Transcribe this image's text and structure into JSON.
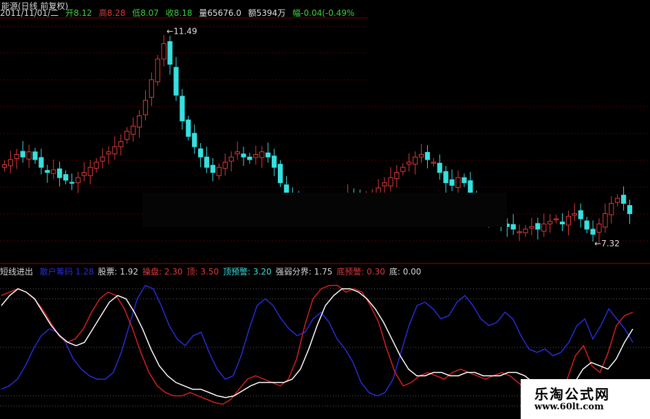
{
  "header": {
    "stock_name": "能源(日线 前复权)",
    "date": "2011/11/01/二",
    "open_label": "开",
    "open": "8.12",
    "high_label": "高",
    "high": "8.28",
    "low_label": "低",
    "low": "8.07",
    "close_label": "收",
    "close": "8.18",
    "volume_label": "量",
    "volume": "65676.0",
    "amount_label": "额",
    "amount": "5394万",
    "change_label": "幅",
    "change": "-0.04(-0.49%"
  },
  "price_annotations": {
    "high_mark": "11.49",
    "low_mark": "7.32"
  },
  "indicator_legend": {
    "name": "短线进出",
    "items": [
      {
        "label": "散户筹码",
        "value": "1.28",
        "color": "#2b2bd8"
      },
      {
        "label": "股票:",
        "value": "1.92",
        "color": "#d8d8d8"
      },
      {
        "label": "操盘:",
        "value": "2.30",
        "color": "#e03a3a"
      },
      {
        "label": "顶:",
        "value": "3.50",
        "color": "#e03a3a"
      },
      {
        "label": "顶预警:",
        "value": "3.20",
        "color": "#37e0e0"
      },
      {
        "label": "强弱分界:",
        "value": "1.75",
        "color": "#d8d8d8"
      },
      {
        "label": "底预警:",
        "value": "0.30",
        "color": "#e03a3a"
      },
      {
        "label": "底:",
        "value": "0.00",
        "color": "#d8d8d8"
      }
    ]
  },
  "watermark": {
    "line1": "乐淘公式网",
    "line2": "www.60lt.com"
  },
  "colors": {
    "up": "#e03a3a",
    "down": "#37e0e0",
    "grid": "#5a0000",
    "white": "#ffffff",
    "blue": "#2b2bd8",
    "red": "#d62020"
  },
  "chart_data": [
    {
      "type": "candlestick",
      "price_range": [
        7.0,
        11.7
      ],
      "candles_close": [
        8.85,
        8.95,
        9.05,
        9.0,
        9.1,
        8.95,
        8.8,
        8.7,
        8.75,
        8.6,
        8.55,
        8.5,
        8.6,
        8.7,
        8.8,
        8.9,
        9.0,
        9.1,
        9.2,
        9.3,
        9.5,
        9.6,
        9.8,
        10.1,
        10.5,
        10.9,
        11.2,
        10.8,
        10.2,
        9.7,
        9.4,
        9.2,
        9.0,
        8.8,
        8.7,
        8.8,
        8.9,
        9.0,
        9.1,
        9.0,
        8.95,
        9.05,
        9.1,
        9.0,
        8.8,
        8.5,
        8.3,
        8.1,
        8.0,
        8.05,
        8.1,
        8.0,
        8.05,
        8.1,
        8.15,
        8.2,
        8.3,
        8.15,
        8.1,
        8.2,
        8.3,
        8.4,
        8.5,
        8.6,
        8.7,
        8.8,
        8.9,
        9.0,
        9.05,
        8.95,
        8.9,
        8.7,
        8.5,
        8.45,
        8.6,
        8.5,
        8.3,
        8.1,
        7.9,
        7.8,
        7.75,
        7.7,
        7.65,
        7.6,
        7.55,
        7.6,
        7.65,
        7.6,
        7.7,
        7.75,
        7.8,
        7.7,
        7.85,
        7.9,
        7.8,
        7.6,
        7.5,
        7.7,
        7.9,
        8.1,
        8.2,
        8.1,
        7.9
      ]
    },
    {
      "type": "line",
      "series": [
        {
          "name": "散户筹码",
          "color": "blue",
          "values": [
            0.5,
            0.6,
            0.8,
            1.2,
            1.7,
            2.1,
            2.3,
            2.2,
            1.9,
            1.4,
            1.1,
            0.9,
            0.8,
            0.8,
            1.0,
            1.6,
            2.4,
            3.2,
            3.6,
            3.5,
            3.0,
            2.4,
            2.0,
            1.8,
            2.1,
            2.2,
            1.6,
            1.1,
            0.8,
            0.9,
            1.5,
            2.3,
            3.0,
            3.2,
            3.0,
            2.6,
            2.3,
            2.1,
            2.2,
            2.6,
            2.8,
            2.5,
            2.0,
            1.7,
            1.3,
            0.7,
            0.4,
            0.3,
            0.4,
            0.8,
            1.6,
            2.4,
            3.0,
            3.1,
            2.9,
            2.6,
            2.7,
            3.1,
            3.3,
            3.0,
            2.6,
            2.4,
            2.5,
            2.8,
            2.6,
            2.1,
            1.7,
            1.6,
            1.7,
            1.5,
            1.6,
            1.9,
            2.4,
            2.6,
            2.0,
            2.4,
            2.9,
            2.6,
            2.3,
            1.9
          ]
        },
        {
          "name": "操盘",
          "color": "red",
          "values": [
            3.3,
            3.4,
            3.5,
            3.4,
            3.2,
            2.9,
            2.5,
            2.1,
            1.9,
            2.0,
            2.3,
            2.8,
            3.2,
            3.4,
            3.3,
            2.9,
            2.3,
            1.6,
            1.0,
            0.6,
            0.4,
            0.3,
            0.3,
            0.4,
            0.3,
            0.2,
            0.1,
            0.05,
            0.2,
            0.5,
            0.8,
            0.9,
            0.8,
            0.7,
            0.6,
            0.8,
            1.4,
            2.4,
            3.2,
            3.5,
            3.6,
            3.6,
            3.4,
            3.5,
            3.4,
            3.0,
            2.5,
            1.7,
            1.0,
            0.6,
            0.7,
            0.9,
            1.0,
            0.9,
            0.8,
            1.0,
            1.1,
            1.0,
            0.9,
            0.8,
            0.9,
            1.0,
            0.9,
            0.7,
            0.5,
            0.3,
            0.2,
            0.2,
            0.4,
            0.8,
            1.5,
            1.8,
            1.2,
            1.0,
            1.6,
            2.4,
            2.7,
            2.8
          ]
        },
        {
          "name": "股票",
          "color": "white",
          "values": [
            3.0,
            3.3,
            3.5,
            3.4,
            3.2,
            2.8,
            2.4,
            2.1,
            1.9,
            1.8,
            1.9,
            2.3,
            2.7,
            3.1,
            3.3,
            3.2,
            2.8,
            2.3,
            1.7,
            1.2,
            0.9,
            0.7,
            0.6,
            0.5,
            0.5,
            0.4,
            0.3,
            0.25,
            0.3,
            0.45,
            0.6,
            0.7,
            0.7,
            0.7,
            0.7,
            0.8,
            1.1,
            1.7,
            2.4,
            3.0,
            3.3,
            3.5,
            3.5,
            3.4,
            3.2,
            2.9,
            2.5,
            2.0,
            1.5,
            1.1,
            0.9,
            0.9,
            1.0,
            1.0,
            0.9,
            0.9,
            1.0,
            1.0,
            0.9,
            0.9,
            0.9,
            1.0,
            1.0,
            0.9,
            0.7,
            0.5,
            0.4,
            0.3,
            0.4,
            0.7,
            1.1,
            1.3,
            1.2,
            1.1,
            1.4,
            1.9,
            2.3
          ]
        }
      ],
      "reference_lines": [
        3.5,
        3.2,
        1.75,
        0.3,
        0.0
      ]
    }
  ]
}
